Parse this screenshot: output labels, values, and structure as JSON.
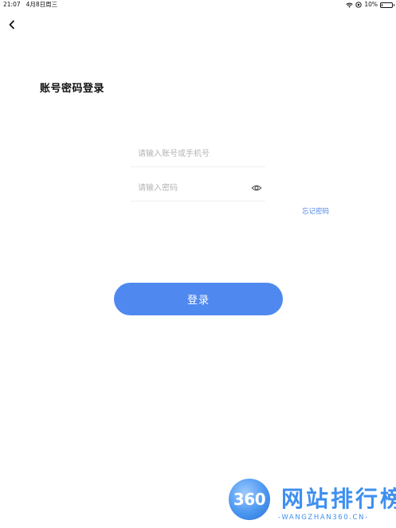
{
  "status_bar": {
    "time": "21:07",
    "date": "4月8日周三",
    "battery_text": "10%",
    "battery_level": 0.1,
    "icons": [
      "wifi-icon",
      "location-icon",
      "battery-icon"
    ]
  },
  "nav": {
    "back_icon": "chevron-left-icon"
  },
  "title": "账号密码登录",
  "form": {
    "account_placeholder": "请输入账号或手机号",
    "account_value": "",
    "password_placeholder": "请输入密码",
    "password_value": "",
    "eye_icon": "eye-icon"
  },
  "forgot_password": "忘记密码",
  "login_button": "登录",
  "watermark": {
    "number": "360",
    "title": "网站排行榜",
    "subtitle": "-WANGZHAN360.CN-"
  },
  "colors": {
    "accent": "#4f89f0",
    "link": "#4f86e8",
    "placeholder": "#b4b4b4",
    "watermark": "#3e8ff0"
  }
}
